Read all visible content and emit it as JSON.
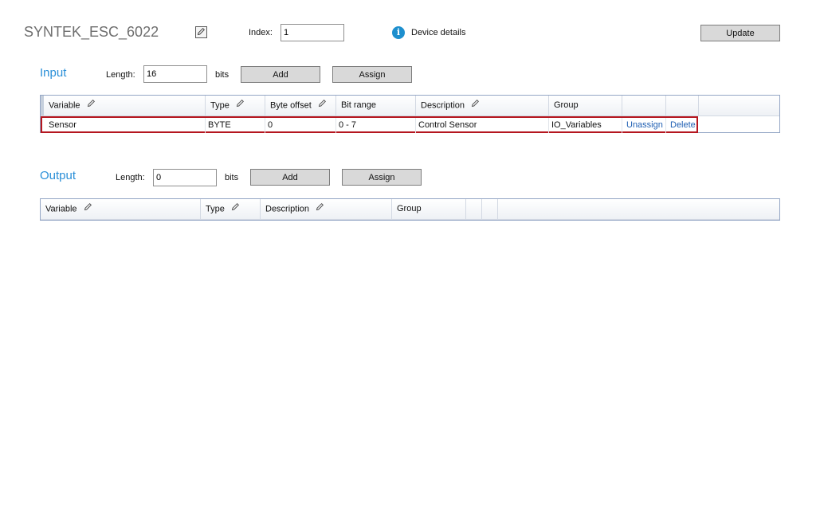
{
  "header": {
    "device_name": "SYNTEK_ESC_6022",
    "index_label": "Index:",
    "index_value": "1",
    "device_details_label": "Device details",
    "update_label": "Update"
  },
  "input": {
    "title": "Input",
    "length_label": "Length:",
    "length_value": "16",
    "bits_label": "bits",
    "add_label": "Add",
    "assign_label": "Assign",
    "columns": [
      "Variable",
      "Type",
      "Byte offset",
      "Bit range",
      "Description",
      "Group"
    ],
    "rows": [
      {
        "variable": "Sensor",
        "type": "BYTE",
        "byte_offset": "0",
        "bit_range": "0 - 7",
        "description": "Control Sensor",
        "group": "IO_Variables",
        "unassign_label": "Unassign",
        "delete_label": "Delete"
      }
    ]
  },
  "output": {
    "title": "Output",
    "length_label": "Length:",
    "length_value": "0",
    "bits_label": "bits",
    "add_label": "Add",
    "assign_label": "Assign",
    "columns": [
      "Variable",
      "Type",
      "Description",
      "Group"
    ]
  },
  "icons": {
    "edit": "pencil-icon",
    "info": "info-icon"
  },
  "colors": {
    "accent": "#2a8fd8",
    "info": "#1d8fce",
    "selected_row_border": "#b5161f",
    "link": "#1f5fb3"
  }
}
